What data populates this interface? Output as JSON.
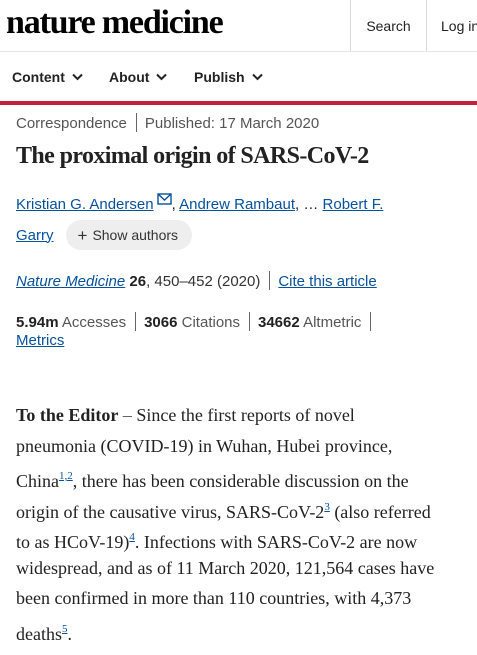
{
  "header": {
    "logo": "nature medicine",
    "search_label": "Search",
    "login_label": "Log in"
  },
  "nav": {
    "items": [
      {
        "label": "Content"
      },
      {
        "label": "About"
      },
      {
        "label": "Publish"
      }
    ]
  },
  "article": {
    "type": "Correspondence",
    "published": "Published: 17 March 2020",
    "title": "The proximal origin of SARS-CoV-2",
    "authors": {
      "first": "Kristian G. Andersen",
      "second": "Andrew Rambaut",
      "ellipsis": "…",
      "last_part1": "Robert F.",
      "last_part2": "Garry",
      "show_authors": "Show authors"
    },
    "citation": {
      "journal": "Nature Medicine",
      "volume": "26",
      "pages_year": ", 450–452 (2020)",
      "cite_label": "Cite this article"
    },
    "metrics": {
      "accesses_value": "5.94m",
      "accesses_label": "Accesses",
      "citations_value": "3066",
      "citations_label": "Citations",
      "altmetric_value": "34662",
      "altmetric_label": "Altmetric",
      "metrics_link": "Metrics"
    },
    "body": {
      "lead": "To the Editor",
      "dash": " – ",
      "l1": "Since the first reports of novel",
      "l2": "pneumonia (COVID-19) in Wuhan, Hubei province,",
      "l3_a": "China",
      "ref_1": "1,2",
      "l3_b": ", there has been considerable discussion on the",
      "l4_a": "origin of the causative virus, SARS-CoV-2",
      "ref_3": "3",
      "l4_b": " (also referred",
      "l5_a": "to as HCoV-19)",
      "ref_4": "4",
      "l5_b": ". Infections with SARS-CoV-2 are now",
      "l6": "widespread, and as of 11 March 2020, 121,564 cases have",
      "l7": "been confirmed in more than 110 countries, with 4,373",
      "l8_a": "deaths",
      "ref_5": "5",
      "l8_b": "."
    }
  },
  "colors": {
    "accent_red": "#c3203a",
    "link_blue": "#06519c"
  },
  "icons": [
    "chevron-down-icon",
    "mail-icon",
    "plus-icon"
  ]
}
